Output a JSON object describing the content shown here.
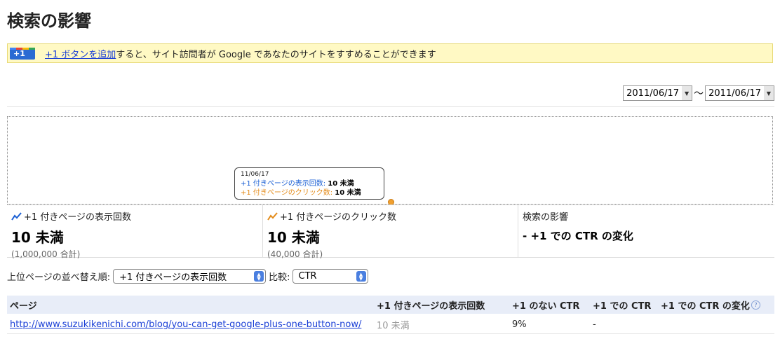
{
  "page": {
    "title": "検索の影響"
  },
  "banner": {
    "badge_text": "+1",
    "link_text": "+1 ボタンを追加",
    "rest_text": "すると、サイト訪問者が Google であなたのサイトをすすめることができます"
  },
  "date_range": {
    "start": "2011/06/17",
    "separator": "〜",
    "end": "2011/06/17"
  },
  "chart_data": {
    "type": "line",
    "tooltip": {
      "date": "11/06/17",
      "rows": [
        {
          "label": "+1 付きページの表示回数:",
          "value": "10 未満",
          "color": "#1a5fd4"
        },
        {
          "label": "+1 付きページのクリック数:",
          "value": "10 未満",
          "color": "#e38b1a"
        }
      ]
    }
  },
  "metrics": [
    {
      "label": "+1 付きページの表示回数",
      "value": "10 未満",
      "total": "(1,000,000 合計)",
      "icon_color": "#1a5fd4"
    },
    {
      "label": "+1 付きページのクリック数",
      "value": "10 未満",
      "total": "(40,000 合計)",
      "icon_color": "#e38b1a"
    },
    {
      "label": "検索の影響",
      "value": "- +1 での CTR の変化"
    }
  ],
  "sort": {
    "label": "上位ページの並べ替え順:",
    "selected": "+1 付きページの表示回数",
    "compare_label": "比較:",
    "compare_selected": "CTR"
  },
  "table": {
    "headers": [
      "ページ",
      "+1 付きページの表示回数",
      "+1 のない CTR",
      "+1 での CTR",
      "+1 での CTR の変化"
    ],
    "rows": [
      {
        "page": "http://www.suzukikenichi.com/blog/you-can-get-google-plus-one-button-now/",
        "impressions": "10 未満",
        "ctr_without": "9%",
        "ctr_with": "-"
      }
    ]
  },
  "colors": {
    "accent_blue": "#1a5fd4",
    "accent_orange": "#e38b1a",
    "banner_bg": "#fff9c4"
  }
}
